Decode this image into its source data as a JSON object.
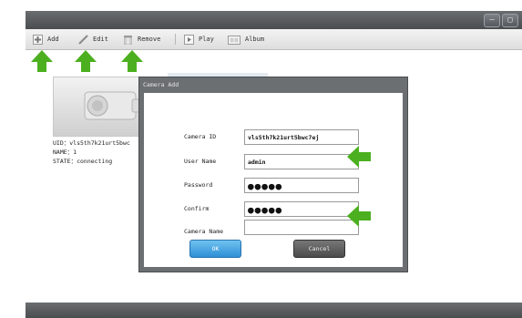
{
  "toolbar": {
    "add": "Add",
    "edit": "Edit",
    "remove": "Remove",
    "play": "Play",
    "album": "Album"
  },
  "window_controls": {
    "minimize": "–",
    "restore": "▢"
  },
  "camera": {
    "uid_label": "UID：",
    "uid_value": "vls5th7k21urt5bwc",
    "name_label": "NAME：",
    "name_value": "1",
    "state_label": "STATE：",
    "state_value": "connecting"
  },
  "dialog": {
    "title": "Camera Add",
    "fields": [
      {
        "label": "Camera ID",
        "value": "vls5th7k21urt5bwc7ej"
      },
      {
        "label": "User Name",
        "value": "admin"
      },
      {
        "label": "Password",
        "value": "●●●●●"
      },
      {
        "label": "Confirm",
        "value": "●●●●●"
      },
      {
        "label": "Camera Name",
        "value": ""
      }
    ],
    "ok": "OK",
    "cancel": "Cancel"
  },
  "icons": [
    "add-icon",
    "edit-icon",
    "remove-icon",
    "play-icon",
    "album-icon",
    "camera-icon",
    "green-arrow-icon"
  ],
  "colors": {
    "accent_green": "#4caf1f",
    "ok_blue": "#2f8fd6",
    "chrome_dark": "#55595e"
  }
}
